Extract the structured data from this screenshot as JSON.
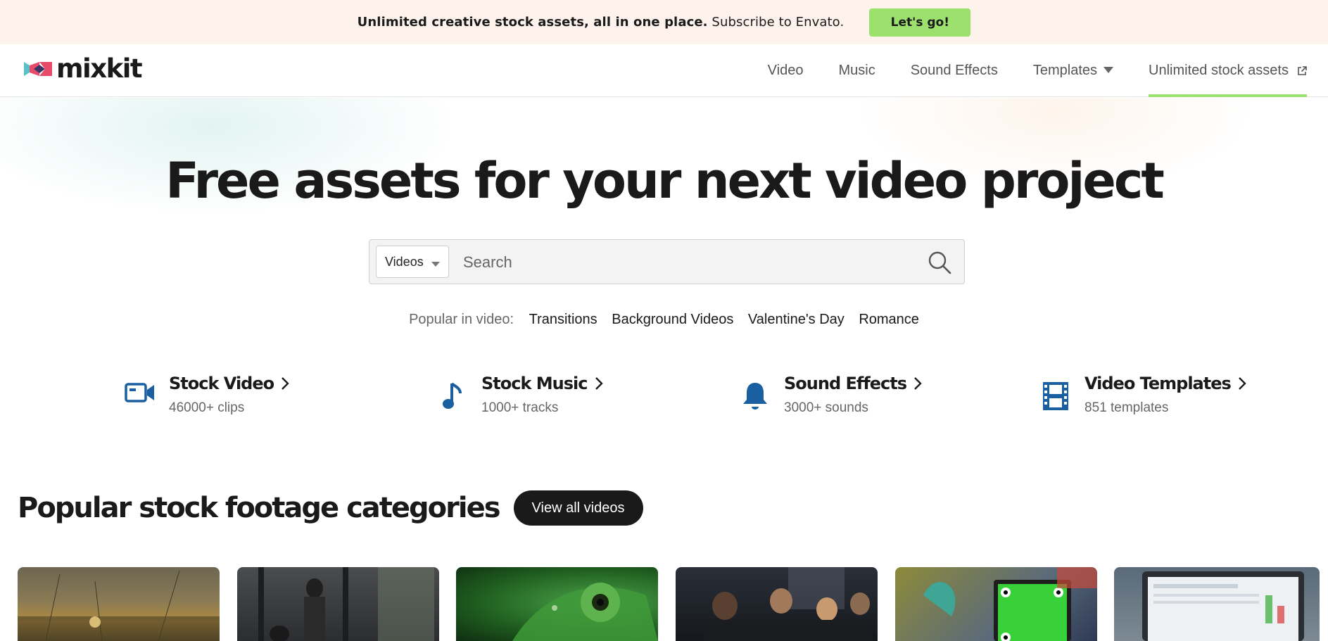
{
  "promo": {
    "text_bold": "Unlimited creative stock assets, all in one place.",
    "text_rest": " Subscribe to Envato.",
    "button_label": "Let's go!"
  },
  "header": {
    "logo_text": "mixkit",
    "nav": [
      {
        "label": "Video"
      },
      {
        "label": "Music"
      },
      {
        "label": "Sound Effects"
      },
      {
        "label": "Templates"
      },
      {
        "label": "Unlimited stock assets"
      }
    ]
  },
  "hero": {
    "headline": "Free assets for your next video project",
    "search": {
      "type_selected": "Videos",
      "placeholder": "Search"
    },
    "popular": {
      "label": "Popular in video:",
      "links": [
        "Transitions",
        "Background Videos",
        "Valentine's Day",
        "Romance"
      ]
    }
  },
  "categories": [
    {
      "title": "Stock Video",
      "subtitle": "46000+ clips",
      "icon": "video-camera-icon"
    },
    {
      "title": "Stock Music",
      "subtitle": "1000+ tracks",
      "icon": "music-note-icon"
    },
    {
      "title": "Sound Effects",
      "subtitle": "3000+ sounds",
      "icon": "bell-icon"
    },
    {
      "title": "Video Templates",
      "subtitle": "851 templates",
      "icon": "film-strip-icon"
    }
  ],
  "section": {
    "title": "Popular stock footage categories",
    "view_all_label": "View all videos"
  },
  "colors": {
    "accent_green": "#9ce06e",
    "icon_blue": "#1a5fa0",
    "promo_bg": "#fdf3ec",
    "dark": "#1a1a1a"
  }
}
